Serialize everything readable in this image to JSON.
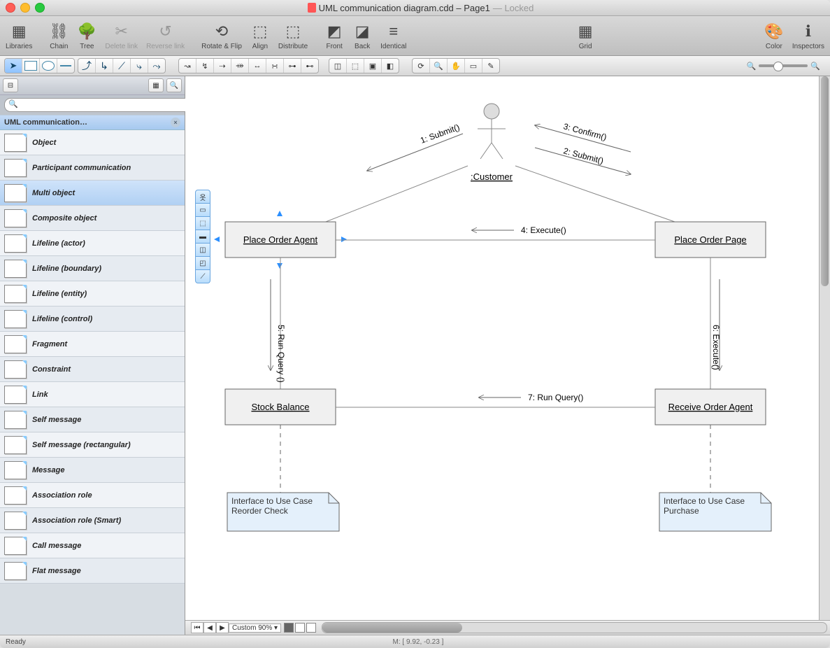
{
  "title": {
    "doc": "UML communication diagram.cdd – Page1",
    "status": "— Locked"
  },
  "toolbar": [
    {
      "label": "Libraries",
      "dis": false
    },
    {
      "label": "Chain",
      "dis": false
    },
    {
      "label": "Tree",
      "dis": false
    },
    {
      "label": "Delete link",
      "dis": true
    },
    {
      "label": "Reverse link",
      "dis": true
    },
    {
      "label": "Rotate & Flip",
      "dis": false
    },
    {
      "label": "Align",
      "dis": false
    },
    {
      "label": "Distribute",
      "dis": false
    },
    {
      "label": "Front",
      "dis": false
    },
    {
      "label": "Back",
      "dis": false
    },
    {
      "label": "Identical",
      "dis": false
    },
    {
      "label": "Grid",
      "dis": false
    },
    {
      "label": "Color",
      "dis": false
    },
    {
      "label": "Inspectors",
      "dis": false
    }
  ],
  "library": {
    "title": "UML communication…",
    "items": [
      "Object",
      "Participant communication",
      "Multi object",
      "Composite object",
      "Lifeline (actor)",
      "Lifeline (boundary)",
      "Lifeline (entity)",
      "Lifeline (control)",
      "Fragment",
      "Constraint",
      "Link",
      "Self message",
      "Self message (rectangular)",
      "Message",
      "Association role",
      "Association role (Smart)",
      "Call message",
      "Flat message"
    ],
    "selected": 2
  },
  "diagram": {
    "actor": ":Customer",
    "boxes": {
      "poa": "Place Order Agent",
      "pop": "Place Order Page",
      "sb": "Stock Balance",
      "roa": "Receive Order Agent"
    },
    "messages": {
      "m1": "1: Submit()",
      "m2": "2: Submit()",
      "m3": "3: Confirm()",
      "m4": "4: Execute()",
      "m5": "5: Run Query ()",
      "m6": "6: Execute()",
      "m7": "7: Run Query()"
    },
    "notes": {
      "n1": "Interface to Use Case Reorder Check",
      "n2": "Interface to Use Case Purchase"
    }
  },
  "zoom": "Custom 90%",
  "status": {
    "ready": "Ready",
    "mouse": "M: [ 9.92, -0.23 ]"
  }
}
